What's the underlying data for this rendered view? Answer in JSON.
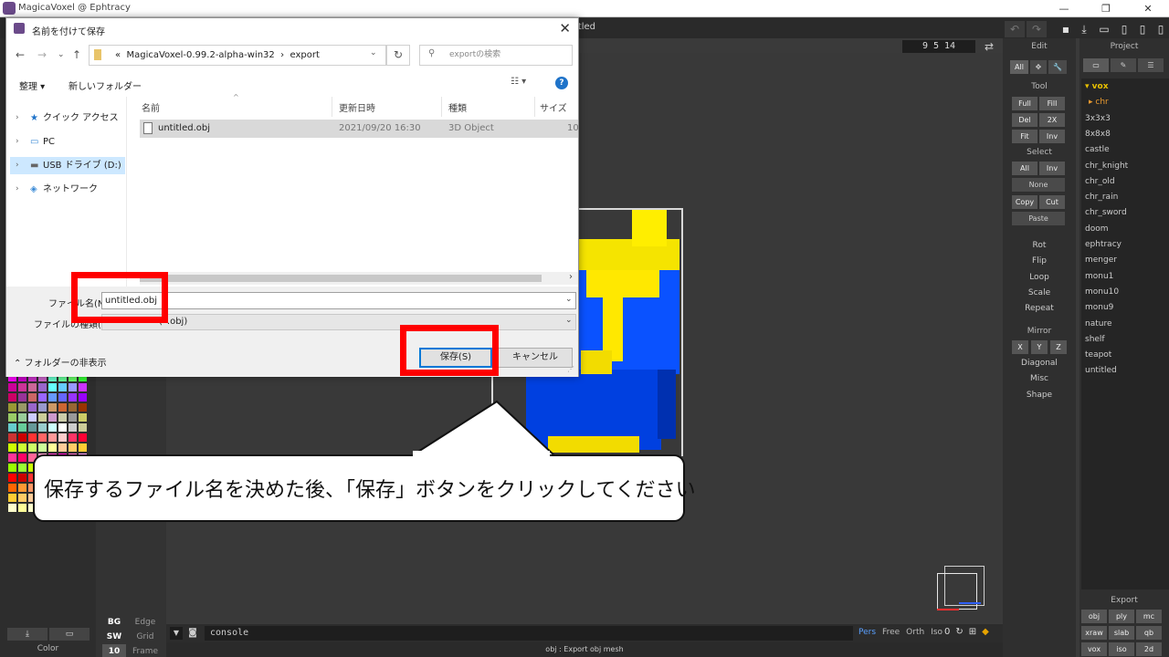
{
  "app": {
    "title": "MagicaVoxel @ Ephtracy",
    "file_title": "itled",
    "dims": "9 5 14",
    "console_text": "console",
    "status": "obj : Export obj mesh",
    "color_label": "Color",
    "view_modes": [
      "Pers",
      "Free",
      "Orth",
      "Iso"
    ],
    "iso_value": "0",
    "bg_rows": [
      {
        "key": "BG",
        "value": "Edge"
      },
      {
        "key": "SW",
        "value": "Grid"
      },
      {
        "key": "10",
        "value": "Frame"
      }
    ]
  },
  "edit_panel": {
    "title": "Edit",
    "all_label": "All",
    "tool_head": "Tool",
    "tool_buttons": [
      "Full",
      "Fill",
      "Del",
      "2X",
      "Fit",
      "Inv"
    ],
    "select_head": "Select",
    "select_buttons": [
      "All",
      "Inv",
      "None",
      "Copy",
      "Cut",
      "Paste"
    ],
    "actions": [
      "Rot",
      "Flip",
      "Loop",
      "Scale",
      "Repeat"
    ],
    "mirror_head": "Mirror",
    "mirror_buttons": [
      "X",
      "Y",
      "Z"
    ],
    "extra": [
      "Diagonal",
      "Misc",
      "Shape"
    ]
  },
  "project_panel": {
    "title": "Project",
    "items": [
      "vox",
      "chr",
      "3x3x3",
      "8x8x8",
      "castle",
      "chr_knight",
      "chr_old",
      "chr_rain",
      "chr_sword",
      "doom",
      "ephtracy",
      "menger",
      "monu1",
      "monu10",
      "monu9",
      "nature",
      "shelf",
      "teapot",
      "untitled"
    ],
    "export_head": "Export",
    "export_buttons": [
      "obj",
      "ply",
      "mc",
      "xraw",
      "slab",
      "qb",
      "vox",
      "iso",
      "2d"
    ]
  },
  "palette_colors": [
    "#ff00ff",
    "#cc00cc",
    "#cc33cc",
    "#cc66cc",
    "#66ffcc",
    "#66ff99",
    "#66ff66",
    "#33ff33",
    "#cc0099",
    "#cc3399",
    "#cc6699",
    "#9966cc",
    "#66ffff",
    "#66ccff",
    "#9999ff",
    "#cc33ff",
    "#cc0066",
    "#993399",
    "#cc6666",
    "#9966ff",
    "#6699ff",
    "#6666ff",
    "#9933ff",
    "#9900ff",
    "#999933",
    "#999966",
    "#9966cc",
    "#9999cc",
    "#cc9966",
    "#cc6633",
    "#996633",
    "#993300",
    "#99cc66",
    "#99cc99",
    "#ccccff",
    "#cccc99",
    "#cc99cc",
    "#ccccaa",
    "#999999",
    "#cccc66",
    "#66cccc",
    "#66cc99",
    "#669999",
    "#99cccc",
    "#ccffff",
    "#ffffff",
    "#cccccc",
    "#cccc99",
    "#cc3333",
    "#cc0000",
    "#ff3333",
    "#ff6666",
    "#ff9999",
    "#ffcccc",
    "#ff3366",
    "#ff0033",
    "#ccff00",
    "#ccff33",
    "#ccff66",
    "#ccff99",
    "#ffff99",
    "#ffcc99",
    "#ffcc66",
    "#ffcc33",
    "#ff3399",
    "#ff0066",
    "#ff6699",
    "#ff99cc",
    "#ff33cc",
    "#ff00cc",
    "#ff66cc",
    "#ff99ff",
    "#99ff00",
    "#99ff33",
    "#ccff00",
    "#cccccc",
    "#cccc66",
    "#cccc33",
    "#cccc00",
    "#ccff00",
    "#ff0000",
    "#cc0000",
    "#ff3333",
    "#ff66cc",
    "#ff33ff",
    "#ff66ff",
    "#ff99ff",
    "#ffccff",
    "#ff6600",
    "#ff9933",
    "#ff9966",
    "#ff6633",
    "#ff3300",
    "#ff9900",
    "#ffcc00",
    "#ff6600",
    "#ffcc33",
    "#ffcc66",
    "#ffcc99",
    "#ffff66",
    "#ffff33",
    "#ffff00",
    "#ffcc00",
    "#ff9900",
    "#ffffcc",
    "#ffff99",
    "#ffffcc",
    "#ffeecc",
    "#ffddcc",
    "#ffe0e0",
    "#ffd0d0",
    "#ffc0c0"
  ],
  "dialog": {
    "title": "名前を付けて保存",
    "address": [
      "MagicaVoxel-0.99.2-alpha-win32",
      "export"
    ],
    "address_prefix": "«",
    "search_placeholder": "exportの検索",
    "organize": "整理 ▾",
    "new_folder": "新しいフォルダー",
    "nav_items": [
      "クイック アクセス",
      "PC",
      "USB ドライブ (D:)",
      "ネットワーク"
    ],
    "columns": [
      "名前",
      "更新日時",
      "種類",
      "サイズ"
    ],
    "file": {
      "name": "untitled.obj",
      "date": "2021/09/20 16:30",
      "type": "3D Object",
      "size": "10"
    },
    "filename_label": "ファイル名(N):",
    "filename_value": "untitled.obj",
    "filetype_label": "ファイルの種類(T):",
    "filetype_value": "(*.obj)",
    "hide_folders": "フォルダーの非表示",
    "save_button": "保存(S)",
    "cancel_button": "キャンセル"
  },
  "callout": {
    "text": "保存するファイル名を決めた後、「保存」ボタンをクリックしてください"
  }
}
